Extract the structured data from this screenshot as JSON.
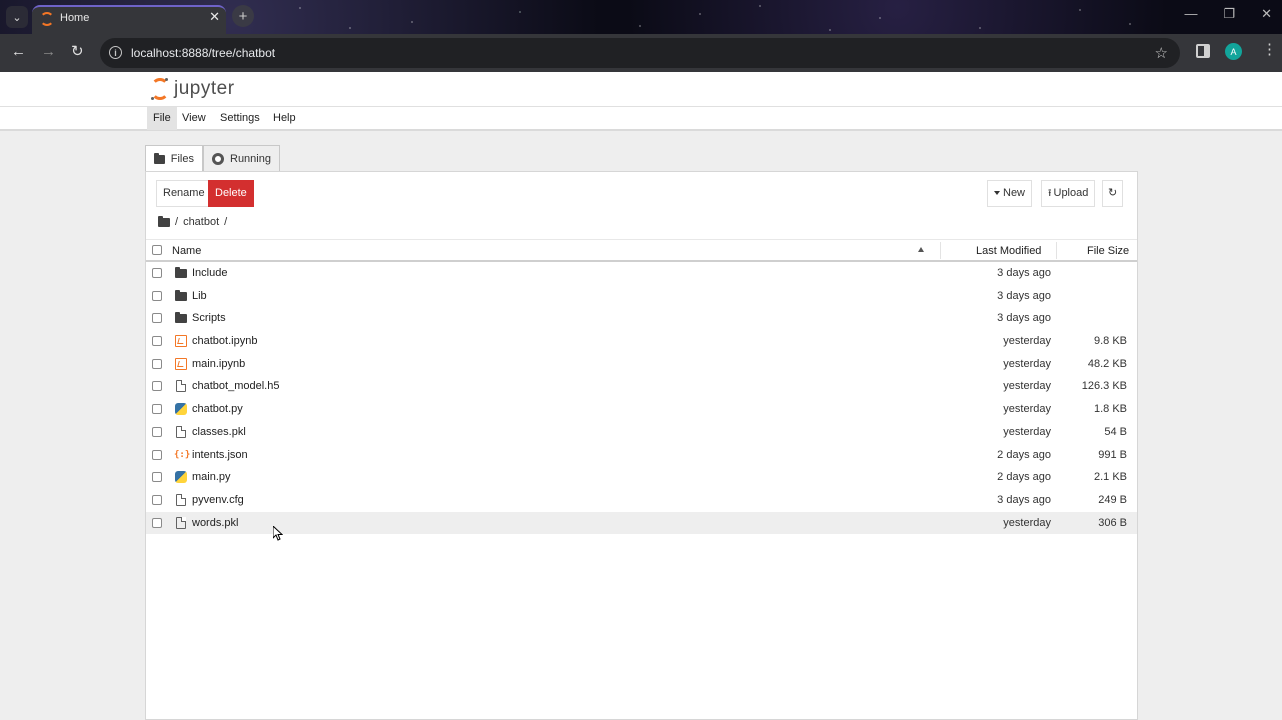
{
  "browser": {
    "tab_title": "Home",
    "close_glyph": "✕",
    "new_tab_glyph": "+",
    "menu_glyph": "⌄",
    "url": "localhost:8888/tree/chatbot",
    "info_glyph": "i",
    "back_glyph": "←",
    "forward_glyph": "→",
    "reload_glyph": "↻",
    "star_glyph": "☆",
    "profile_initial": "A",
    "kebab_glyph": "⋮",
    "minimize_glyph": "—",
    "maximize_glyph": "❐",
    "window_close_glyph": "✕"
  },
  "jupyter": {
    "logo_text": "jupyter",
    "menu": [
      "File",
      "View",
      "Settings",
      "Help"
    ],
    "tabs": {
      "files": "Files",
      "running": "Running"
    },
    "buttons": {
      "rename": "Rename",
      "delete": "Delete",
      "new": "New",
      "upload": "Upload",
      "refresh": "↻",
      "upload_glyph": "⭱"
    },
    "breadcrumb": {
      "root": "/",
      "folder": "chatbot",
      "sep": "/"
    },
    "columns": {
      "name": "Name",
      "modified": "Last Modified",
      "size": "File Size"
    },
    "files": [
      {
        "name": "Include",
        "modified": "3 days ago",
        "size": "",
        "icon": "folder-icon"
      },
      {
        "name": "Lib",
        "modified": "3 days ago",
        "size": "",
        "icon": "folder-icon"
      },
      {
        "name": "Scripts",
        "modified": "3 days ago",
        "size": "",
        "icon": "folder-icon"
      },
      {
        "name": "chatbot.ipynb",
        "modified": "yesterday",
        "size": "9.8 KB",
        "icon": "notebook-icon"
      },
      {
        "name": "main.ipynb",
        "modified": "yesterday",
        "size": "48.2 KB",
        "icon": "notebook-icon"
      },
      {
        "name": "chatbot_model.h5",
        "modified": "yesterday",
        "size": "126.3 KB",
        "icon": "file-icon"
      },
      {
        "name": "chatbot.py",
        "modified": "yesterday",
        "size": "1.8 KB",
        "icon": "python-icon"
      },
      {
        "name": "classes.pkl",
        "modified": "yesterday",
        "size": "54 B",
        "icon": "file-icon"
      },
      {
        "name": "intents.json",
        "modified": "2 days ago",
        "size": "991 B",
        "icon": "json-icon"
      },
      {
        "name": "main.py",
        "modified": "2 days ago",
        "size": "2.1 KB",
        "icon": "python-icon"
      },
      {
        "name": "pyvenv.cfg",
        "modified": "3 days ago",
        "size": "249 B",
        "icon": "file-icon"
      },
      {
        "name": "words.pkl",
        "modified": "yesterday",
        "size": "306 B",
        "icon": "file-icon"
      }
    ],
    "json_glyph": "{:}"
  },
  "colors": {
    "accent": "#f37726",
    "danger": "#d32f2f",
    "tab_accent": "#6f63c9"
  }
}
